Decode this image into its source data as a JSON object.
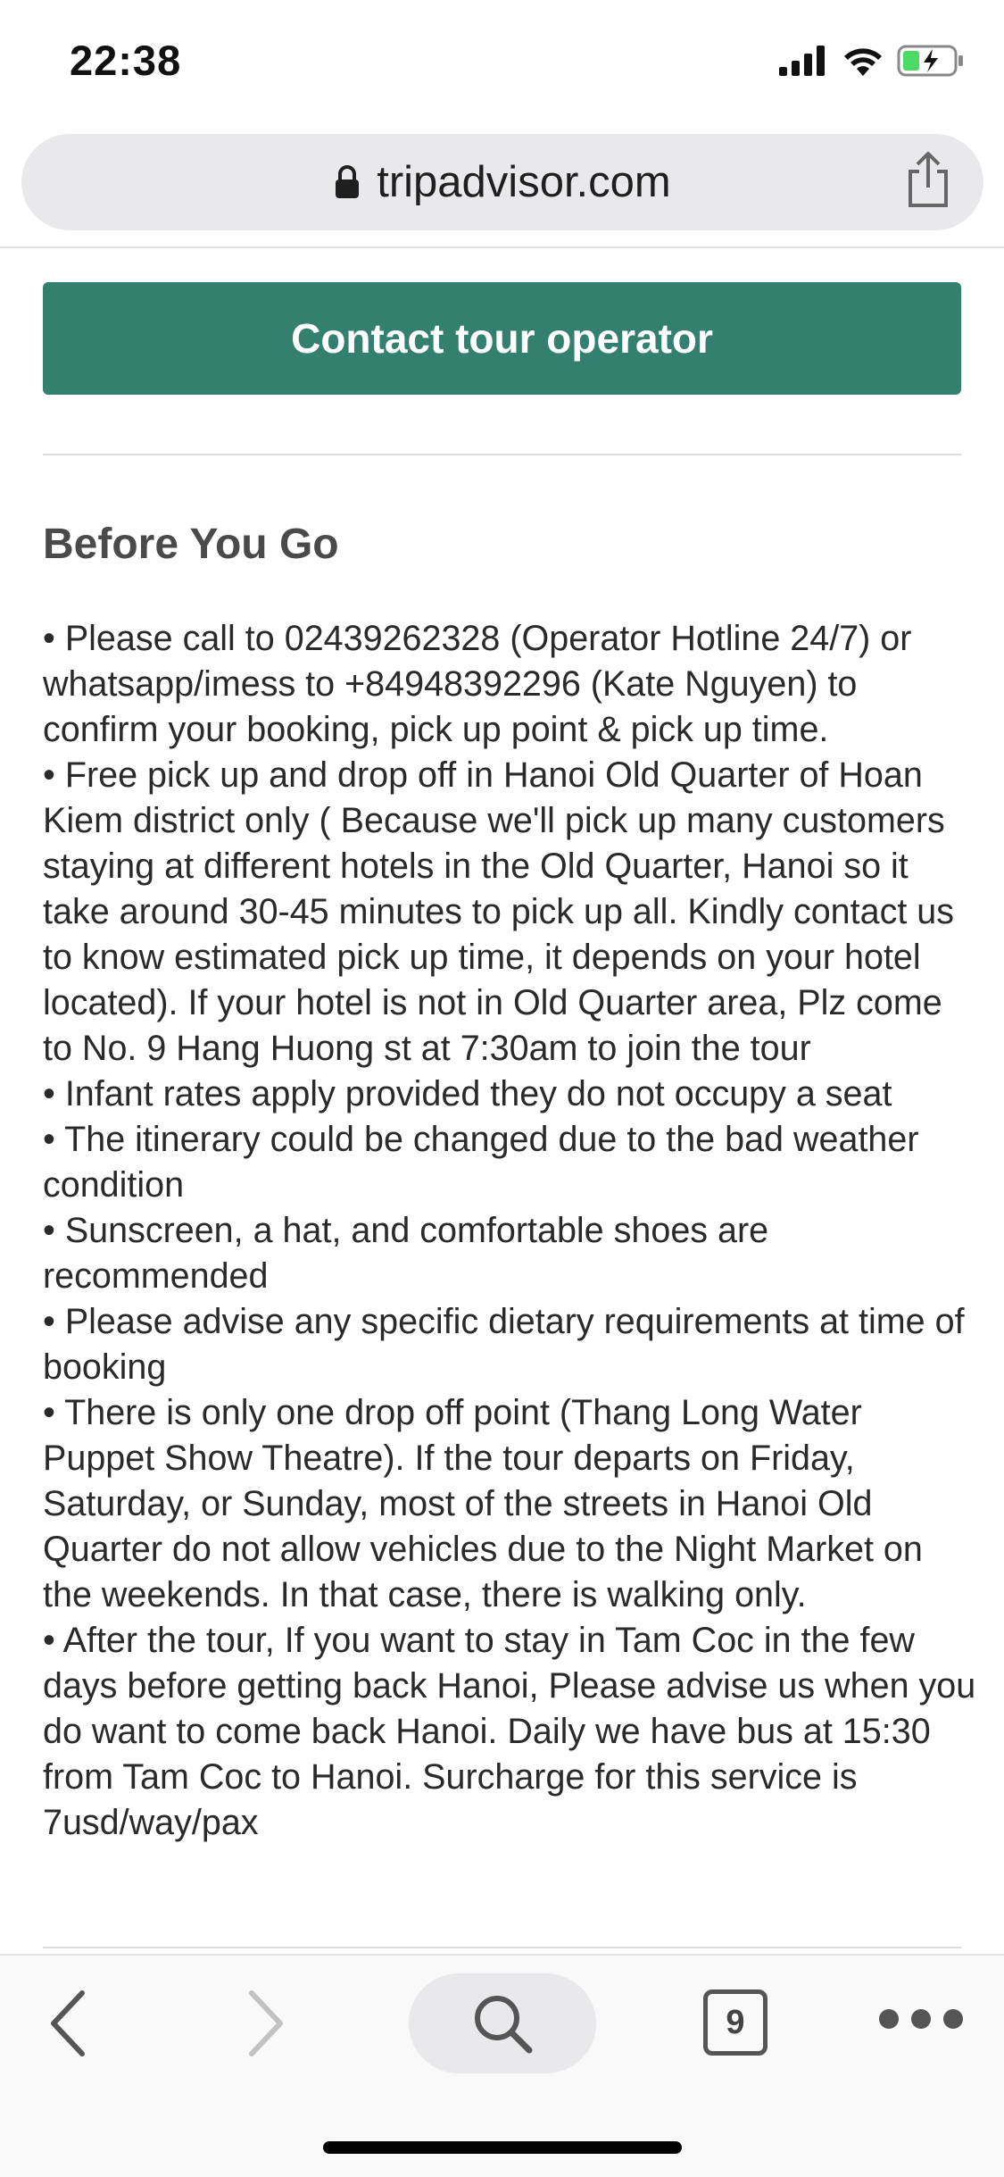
{
  "status_bar": {
    "time": "22:38"
  },
  "url_bar": {
    "domain": "tripadvisor.com"
  },
  "contact_button": {
    "label": "Contact tour operator"
  },
  "section": {
    "title": "Before You Go",
    "items": [
      "Please call to 02439262328 (Operator Hotline 24/7) or whatsapp/imess to +84948392296 (Kate Nguyen) to confirm your booking, pick up point & pick up time.",
      "Free pick up and drop off in Hanoi Old Quarter of Hoan Kiem district only ( Because we'll pick up many customers staying at different hotels in the Old Quarter, Hanoi so it take around 30-45 minutes to pick up all. Kindly contact us to know estimated pick up time, it depends on your hotel located). If your hotel is not in Old Quarter area, Plz come to No. 9 Hang Huong st at 7:30am to join the tour",
      "Infant rates apply provided they do not occupy a seat",
      "The itinerary could be changed due to the bad weather condition",
      "Sunscreen, a hat, and comfortable shoes are recommended",
      "Please advise any specific dietary requirements at time of booking",
      "There is only one drop off point (Thang Long Water Puppet Show Theatre). If the tour departs on Friday, Saturday, or Sunday, most of the streets in Hanoi Old Quarter do not allow vehicles due to the Night Market on the weekends. In that case, there is walking only.",
      "After the tour, If you want to stay in Tam Coc in the few days before getting back Hanoi, Please advise us when you do want to come back Hanoi. Daily we have bus at 15:30 from Tam Coc to Hanoi. Surcharge for this service is 7usd/way/pax"
    ]
  },
  "toolbar": {
    "tab_count": "9"
  },
  "colors": {
    "brand_green": "#34806f",
    "toolbar_bg": "#f9f9f9",
    "pill_bg": "#e9e9eb"
  }
}
